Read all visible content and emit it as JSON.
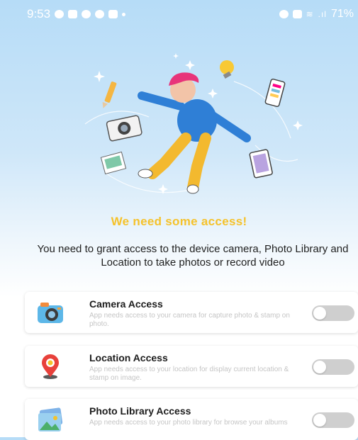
{
  "status_bar": {
    "time": "9:53",
    "battery": "71%",
    "notification_icons": [
      "messenger-icon",
      "youtube-icon",
      "tiktok-icon",
      "tiktok-icon",
      "shopping-icon",
      "dot-icon"
    ],
    "system_icons": [
      "alarm-icon",
      "vibrate-icon",
      "wifi-icon",
      "signal-icon"
    ]
  },
  "hero": {
    "illustration": "person-floating-with-camera-phone-photo-icons"
  },
  "title": "We need some access!",
  "subtitle": "You need to grant access to the device camera, Photo Library and Location to take photos or record video",
  "permissions": [
    {
      "icon": "camera-icon",
      "title": "Camera Access",
      "description": "App needs access to your camera for capture photo & stamp on photo.",
      "enabled": false
    },
    {
      "icon": "location-pin-icon",
      "title": "Location Access",
      "description": "App needs access to your location for display current location & stamp on image.",
      "enabled": false
    },
    {
      "icon": "photo-library-icon",
      "title": "Photo Library Access",
      "description": "App needs access to your photo library for browse your albums",
      "enabled": false
    }
  ],
  "colors": {
    "accent": "#f5c22b",
    "toggle_off": "#cfcfcf",
    "background_top": "#b6dcf7"
  }
}
